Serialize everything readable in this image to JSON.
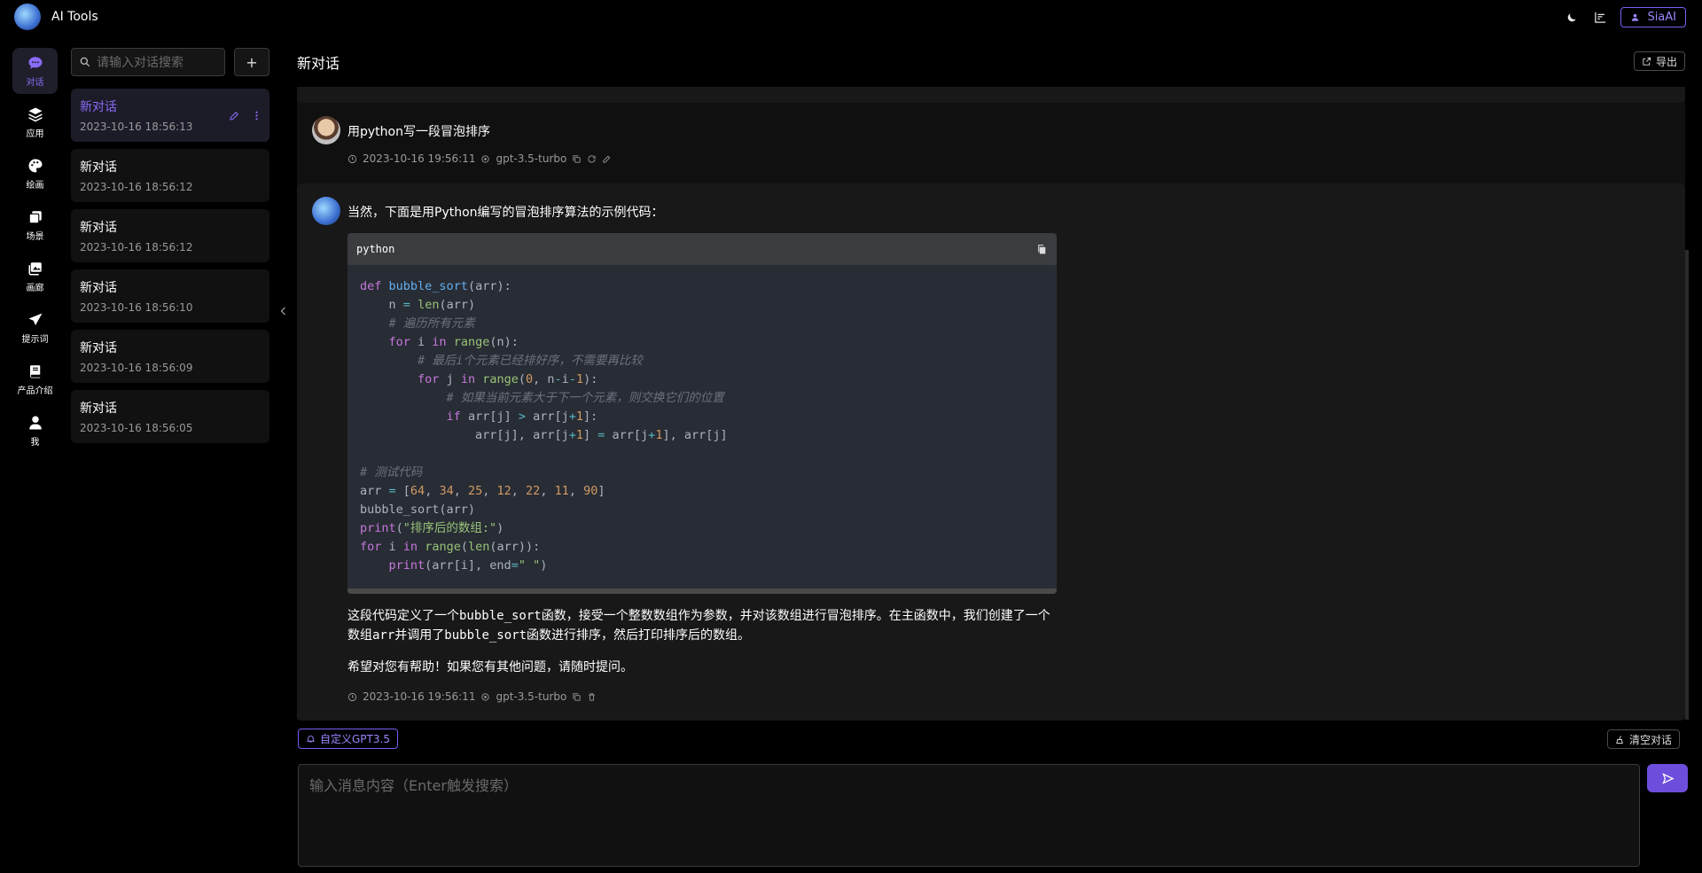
{
  "app": {
    "title": "AI Tools"
  },
  "header": {
    "user_label": "SiaAI"
  },
  "nav": {
    "items": [
      {
        "label": "对话"
      },
      {
        "label": "应用"
      },
      {
        "label": "绘画"
      },
      {
        "label": "场景"
      },
      {
        "label": "画廊"
      },
      {
        "label": "提示词"
      },
      {
        "label": "产品介绍"
      },
      {
        "label": "我"
      }
    ]
  },
  "conversations": {
    "search_placeholder": "请输入对话搜索",
    "add_label": "+",
    "items": [
      {
        "title": "新对话",
        "date": "2023-10-16 18:56:13"
      },
      {
        "title": "新对话",
        "date": "2023-10-16 18:56:12"
      },
      {
        "title": "新对话",
        "date": "2023-10-16 18:56:12"
      },
      {
        "title": "新对话",
        "date": "2023-10-16 18:56:10"
      },
      {
        "title": "新对话",
        "date": "2023-10-16 18:56:09"
      },
      {
        "title": "新对话",
        "date": "2023-10-16 18:56:05"
      }
    ]
  },
  "main": {
    "title": "新对话",
    "export_label": "导出",
    "user_message": "用python写一段冒泡排序",
    "user_meta": {
      "time": "2023-10-16 19:56:11",
      "model": "gpt-3.5-turbo"
    },
    "bot_intro": "当然，下面是用Python编写的冒泡排序算法的示例代码：",
    "code_lang": "python",
    "para1_a": "这段代码定义了一个",
    "para1_code1": "bubble_sort",
    "para1_b": "函数，接受一个整数数组作为参数，并对该数组进行冒泡排序。在主函数中，我们创建了一个数组",
    "para1_code2": "arr",
    "para1_c": "并调用了",
    "para1_code3": "bubble_sort",
    "para1_d": "函数进行排序，然后打印排序后的数组。",
    "para2": "希望对您有帮助！如果您有其他问题，请随时提问。",
    "bot_meta": {
      "time": "2023-10-16 19:56:11",
      "model": "gpt-3.5-turbo"
    }
  },
  "footer": {
    "tag_label": "自定义GPT3.5",
    "clear_label": "清空对话",
    "input_placeholder": "输入消息内容（Enter触发搜索）"
  }
}
